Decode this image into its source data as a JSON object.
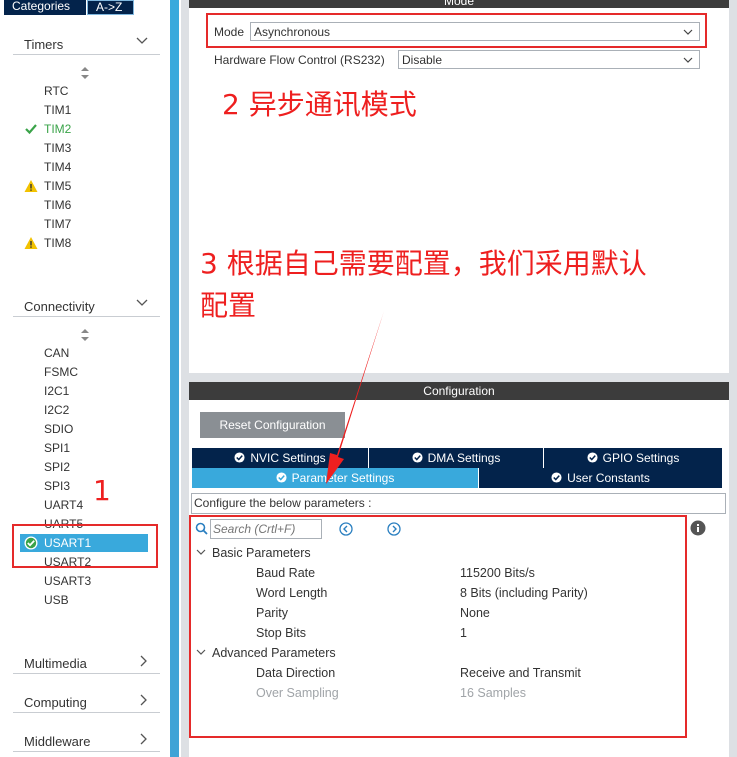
{
  "sidebar": {
    "tabs": {
      "categories": "Categories",
      "az": "A->Z"
    },
    "timers": {
      "title": "Timers",
      "items": [
        {
          "label": "RTC",
          "status": "none"
        },
        {
          "label": "TIM1",
          "status": "none"
        },
        {
          "label": "TIM2",
          "status": "ok"
        },
        {
          "label": "TIM3",
          "status": "none"
        },
        {
          "label": "TIM4",
          "status": "none"
        },
        {
          "label": "TIM5",
          "status": "warning"
        },
        {
          "label": "TIM6",
          "status": "none"
        },
        {
          "label": "TIM7",
          "status": "none"
        },
        {
          "label": "TIM8",
          "status": "warning"
        }
      ]
    },
    "connectivity": {
      "title": "Connectivity",
      "items": [
        {
          "label": "CAN",
          "status": "none"
        },
        {
          "label": "FSMC",
          "status": "none"
        },
        {
          "label": "I2C1",
          "status": "none"
        },
        {
          "label": "I2C2",
          "status": "none"
        },
        {
          "label": "SDIO",
          "status": "none"
        },
        {
          "label": "SPI1",
          "status": "none"
        },
        {
          "label": "SPI2",
          "status": "none"
        },
        {
          "label": "SPI3",
          "status": "none"
        },
        {
          "label": "UART4",
          "status": "none"
        },
        {
          "label": "UART5",
          "status": "none"
        },
        {
          "label": "USART1",
          "status": "selected"
        },
        {
          "label": "USART2",
          "status": "none"
        },
        {
          "label": "USART3",
          "status": "none"
        },
        {
          "label": "USB",
          "status": "none"
        }
      ]
    },
    "categories": [
      "Multimedia",
      "Computing",
      "Middleware"
    ]
  },
  "mode": {
    "header": "Mode",
    "mode_label": "Mode",
    "mode_value": "Asynchronous",
    "flow_label": "Hardware Flow Control (RS232)",
    "flow_value": "Disable"
  },
  "annotations": {
    "step1": "1",
    "step2": "2 异步通讯模式",
    "step3_line1": "3 根据自己需要配置，我们采用默认",
    "step3_line2": "配置",
    "color": "#ee1f1f"
  },
  "configuration": {
    "header": "Configuration",
    "reset_label": "Reset Configuration",
    "tabs_row1": [
      "NVIC Settings",
      "DMA Settings",
      "GPIO Settings"
    ],
    "tabs_row2": [
      "Parameter Settings",
      "User Constants"
    ],
    "active_tab": "Parameter Settings",
    "description": "Configure the below parameters :",
    "search_placeholder": "Search (Crtl+F)",
    "basic": {
      "title": "Basic Parameters",
      "params": [
        {
          "name": "Baud Rate",
          "value": "115200 Bits/s"
        },
        {
          "name": "Word Length",
          "value": "8 Bits (including Parity)"
        },
        {
          "name": "Parity",
          "value": "None"
        },
        {
          "name": "Stop Bits",
          "value": "1"
        }
      ]
    },
    "advanced": {
      "title": "Advanced Parameters",
      "params": [
        {
          "name": "Data Direction",
          "value": "Receive and Transmit"
        },
        {
          "name": "Over Sampling",
          "value": "16 Samples",
          "disabled": true
        }
      ]
    }
  },
  "colors": {
    "navy": "#03234b",
    "accent_blue": "#39a9dc",
    "ok_green": "#3aa349",
    "warning_yellow": "#f2c200",
    "annotation_red": "#ee1f1f"
  }
}
